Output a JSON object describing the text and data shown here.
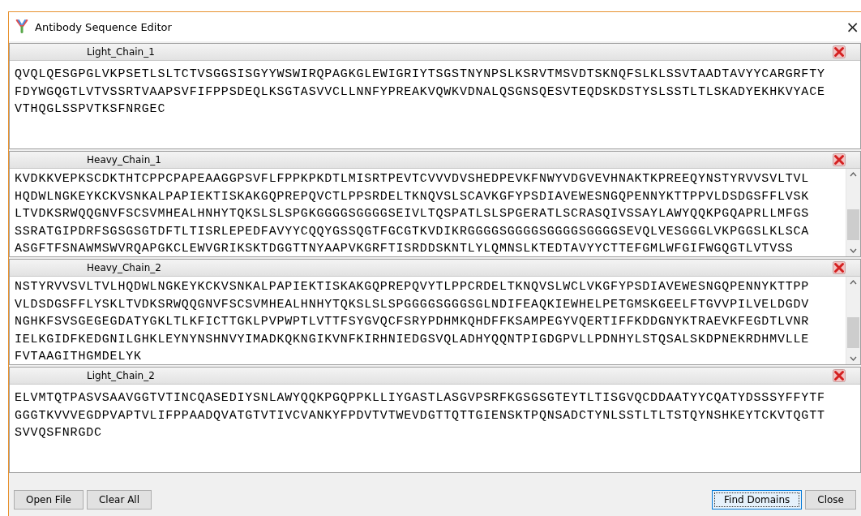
{
  "window": {
    "title": "Antibody Sequence Editor",
    "close": "×"
  },
  "chains": [
    {
      "name": "Light_Chain_1",
      "scrollbar": false,
      "lines": [
        "QVQLQESGPGLVKPSETLSLTCTVSGGSISGYYWSWIRQPAGKGLEWIGRIYTSGSTNYNPSLKSRVTMSVDTSKNQFSLKLSSVTAADTAVYYCARGRFTY",
        "FDYWGQGTLVTVSSRTVAAPSVFIFPPSDEQLKSGTASVVCLLNNFYPREAKVQWKVDNALQSGNSQESVTEQDSKDSTYSLSSTLTLSKADYEKHKVYACE",
        "VTHQGLSSPVTKSFNRGEC"
      ]
    },
    {
      "name": "Heavy_Chain_1",
      "scrollbar": true,
      "lines": [
        "KVDKKVEPKSCDKTHTCPPCPAPEAAGGPSVFLFPPKPKDTLMISRTPEVTCVVVDVSHEDPEVKFNWYVDGVEVHNAKTKPREEQYNSTYRVVSVLTVL",
        "HQDWLNGKEYKCKVSNKALPAPIEKTISKAKGQPREPQVCTLPPSRDELTKNQVSLSCAVKGFYPSDIAVEWESNGQPENNYKTTPPVLDSDGSFFLVSK",
        "LTVDKSRWQQGNVFSCSVMHEALHNHYTQKSLSLSPGKGGGGSGGGGSEIVLTQSPATLSLSPGERATLSCRASQIVSSAYLAWYQQKPGQAPRLLMFGS",
        "SSRATGIPDRFSGSGSGTDFTLTISRLEPEDFAVYYCQQYGSSQGTFGCGTKVDIKRGGGGSGGGGSGGGGSGGGGSEVQLVESGGGLVKPGGSLKLSCA",
        "ASGFTFSNAWMSWVRQAPGKCLEWVGRIKSKTDGGTTNYAAPVKGRFTISRDDSKNTLYLQMNSLKTEDTAVYYCTTEFGMLWFGIFWGQGTLVTVSS"
      ]
    },
    {
      "name": "Heavy_Chain_2",
      "scrollbar": true,
      "lines": [
        "NSTYRVVSVLTVLHQDWLNGKEYKCKVSNKALPAPIEKTISKAKGQPREPQVYTLPPCRDELTKNQVSLWCLVKGFYPSDIAVEWESNGQPENNYKTTPP",
        "VLDSDGSFFLYSKLTVDKSRWQQGNVFSCSVMHEALHNHYTQKSLSLSPGGGGSGGGSGLNDIFEAQKIEWHELPETGMSKGEELFTGVVPILVELDGDV",
        "NGHKFSVSGEGEGDATYGKLTLKFICTTGKLPVPWPTLVTTFSYGVQCFSRYPDHMKQHDFFKSAMPEGYVQERTIFFKDDGNYKTRAEVKFEGDTLVNR",
        "IELKGIDFKEDGNILGHKLEYNYNSHNVYIMADKQKNGIKVNFKIRHNIEDGSVQLADHYQQNTPIGDGPVLLPDNHYLSTQSALSKDPNEKRDHMVLLE",
        "FVTAAGITHGMDELYK"
      ]
    },
    {
      "name": "Light_Chain_2",
      "scrollbar": false,
      "lines": [
        "ELVMTQTPASVSAAVGGTVTINCQASEDIYSNLAWYQQKPGQPPKLLIYGASTLASGVPSRFKGSGSGTEYTLTISGVQCDDAATYYCQATYDSSSYFFYTF",
        "GGGTKVVVEGDPVAPTVLIFPPAADQVATGTVTIVCVANKYFPDVTVTWEVDGTTQTTGIENSKTPQNSADCTYNLSSTLTLTSTQYNSHKEYTCKVTQGTT",
        "SVVQSFNRGDC"
      ]
    }
  ],
  "buttons_left": [
    "Open File",
    "Clear All"
  ],
  "buttons_right": [
    {
      "label": "Find Domains",
      "selected": true
    },
    {
      "label": "Close",
      "selected": false
    }
  ]
}
